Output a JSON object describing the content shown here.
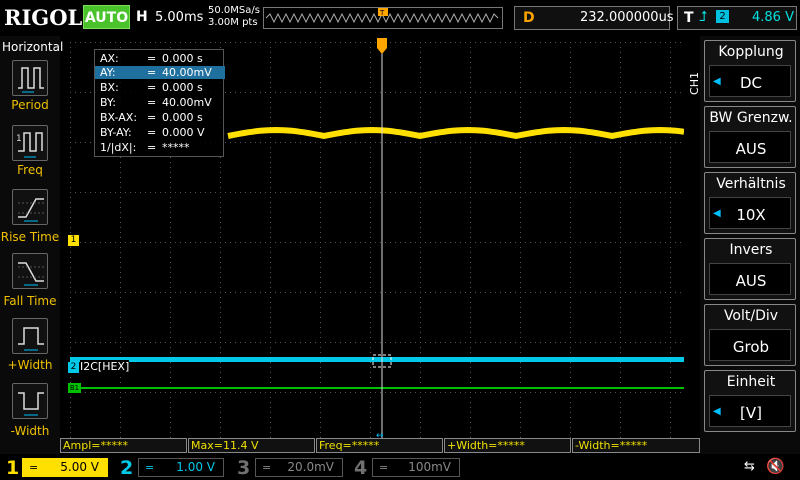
{
  "header": {
    "logo": "RIGOL",
    "run_state": "AUTO",
    "timebase_label": "H",
    "timebase": "5.00ms",
    "sample_rate": "50.0MSa/s",
    "memory_depth": "3.00M pts",
    "delay_label": "D",
    "delay": "232.000000us",
    "trigger_label": "T",
    "trigger_source": "2",
    "trigger_level": "4.86 V"
  },
  "left_menu": {
    "title": "Horizontal",
    "items": [
      {
        "label": "Period",
        "icon": "period-icon"
      },
      {
        "label": "Freq",
        "icon": "freq-icon"
      },
      {
        "label": "Rise Time",
        "icon": "rise-time-icon"
      },
      {
        "label": "Fall Time",
        "icon": "fall-time-icon"
      },
      {
        "label": "+Width",
        "icon": "pos-width-icon"
      },
      {
        "label": "-Width",
        "icon": "neg-width-icon"
      }
    ]
  },
  "cursor_panel": {
    "rows": [
      {
        "key": "AX:",
        "eq": "=",
        "value": "0.000 s"
      },
      {
        "key": "AY:",
        "eq": "=",
        "value": "40.00mV"
      },
      {
        "key": "BX:",
        "eq": "=",
        "value": "0.000 s"
      },
      {
        "key": "BY:",
        "eq": "=",
        "value": "40.00mV"
      },
      {
        "key": "BX-AX:",
        "eq": "=",
        "value": "0.000 s"
      },
      {
        "key": "BY-AY:",
        "eq": "=",
        "value": "0.000 V"
      },
      {
        "key": "1/|dX|:",
        "eq": "=",
        "value": "*****"
      }
    ]
  },
  "waveform_labels": {
    "ch1_marker": "1",
    "ch2_marker": "2",
    "ch2_decode": "I2C[HEX]",
    "bus_marker": "B1"
  },
  "right_menu": {
    "channel": "CH1",
    "items": [
      {
        "title": "Kopplung",
        "value": "DC"
      },
      {
        "title": "BW Grenzw.",
        "value": "AUS"
      },
      {
        "title": "Verhältnis",
        "value": "10X"
      },
      {
        "title": "Invers",
        "value": "AUS"
      },
      {
        "title": "Volt/Div",
        "value": "Grob"
      },
      {
        "title": "Einheit",
        "value": "[V]"
      }
    ]
  },
  "measurements": [
    "Ampl=*****",
    "Max=11.4 V",
    "Freq=*****",
    "+Width=*****",
    "-Width=*****"
  ],
  "channels": [
    {
      "num": "1",
      "coupling": "=",
      "scale": "5.00 V",
      "color": "#ffe000"
    },
    {
      "num": "2",
      "coupling": "=",
      "scale": "1.00 V",
      "color": "#00c8e8"
    },
    {
      "num": "3",
      "coupling": "=",
      "scale": "20.0mV",
      "color": "#c000c0"
    },
    {
      "num": "4",
      "coupling": "=",
      "scale": "100mV",
      "color": "#2060ff"
    }
  ],
  "colors": {
    "ch1": "#ffe000",
    "ch2": "#00c8e8",
    "bus": "#00c000",
    "accent": "#ffa500",
    "run": "#4ac22c"
  }
}
